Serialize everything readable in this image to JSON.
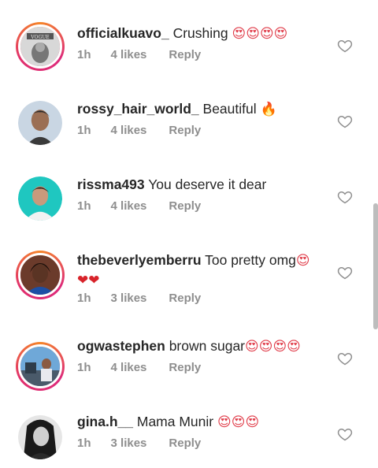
{
  "comments": [
    {
      "username": "officialkuavo_",
      "text": "Crushing",
      "emoji": "😍😍😍😍",
      "time": "1h",
      "likes": "4 likes",
      "reply": "Reply",
      "avatar_icon": "vogue-cover-avatar",
      "story_ring": true
    },
    {
      "username": "rossy_hair_world_",
      "text": "Beautiful",
      "emoji": "🔥",
      "time": "1h",
      "likes": "4 likes",
      "reply": "Reply",
      "avatar_icon": "selfie-avatar",
      "story_ring": false
    },
    {
      "username": "rissma493",
      "text": "You deserve it dear",
      "emoji": "",
      "time": "1h",
      "likes": "4 likes",
      "reply": "Reply",
      "avatar_icon": "teal-background-avatar",
      "story_ring": false
    },
    {
      "username": "thebeverlyemberru",
      "text": "Too pretty omg",
      "emoji": "😍",
      "emoji2": "❤❤",
      "time": "1h",
      "likes": "3 likes",
      "reply": "Reply",
      "avatar_icon": "portrait-avatar",
      "story_ring": true
    },
    {
      "username": "ogwastephen",
      "text": "brown sugar",
      "emoji": "😍😍😍😍",
      "time": "1h",
      "likes": "4 likes",
      "reply": "Reply",
      "avatar_icon": "outdoor-photo-avatar",
      "story_ring": true
    },
    {
      "username": "gina.h__",
      "text": "Mama Munir",
      "emoji": "😍😍😍",
      "time": "1h",
      "likes": "3 likes",
      "reply": "Reply",
      "avatar_icon": "bw-portrait-avatar",
      "story_ring": false
    }
  ],
  "colors": {
    "meta_gray": "#8e8e8e",
    "text_dark": "#262626",
    "ring_gradient": [
      "#f58529",
      "#dd2a7b"
    ]
  },
  "icons": {
    "like": "heart-outline-icon"
  }
}
